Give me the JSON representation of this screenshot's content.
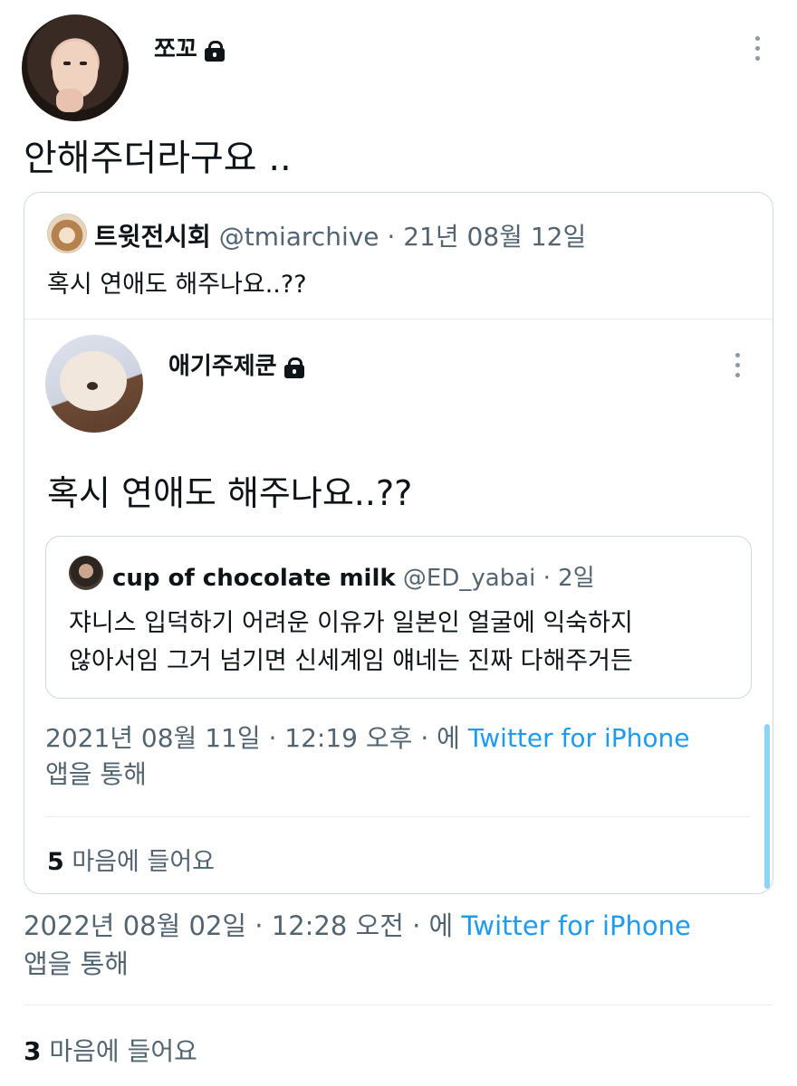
{
  "tweet": {
    "author_name": "쪼꼬",
    "text": "안해주더라구요 ..",
    "timestamp": "2022년 08월 02일 · 12:28 오전",
    "via_prefix": " · 에 ",
    "source": "Twitter for iPhone",
    "via_suffix": "앱을 통해",
    "likes_count": "3",
    "likes_label": " 마음에 들어요"
  },
  "quote": {
    "author_name": "트윗전시회",
    "handle": "@tmiarchive",
    "date": "21년 08월 12일",
    "sep": " · ",
    "text": "혹시 연애도 해주나요..??"
  },
  "inner_tweet": {
    "author_name": "애기주제쿤",
    "text": "혹시 연애도 해주나요..??",
    "timestamp": "2021년 08월 11일 · 12:19 오후",
    "via_prefix": " · 에 ",
    "source": "Twitter for iPhone",
    "via_suffix": "앱을 통해",
    "likes_count": "5",
    "likes_label": " 마음에 들어요"
  },
  "nested_quote": {
    "author_name": "cup of chocolate milk",
    "handle": "@ED_yabai",
    "date": "2일",
    "sep": " · ",
    "line1": "쟈니스 입덕하기 어려운 이유가 일본인 얼굴에 익숙하지",
    "line2": "않아서임 그거 넘기면 신세계임 얘네는 진짜 다해주거든"
  },
  "colors": {
    "accent": "#1d9bf0",
    "secondary_text": "#536471",
    "border": "#cfd9de"
  }
}
